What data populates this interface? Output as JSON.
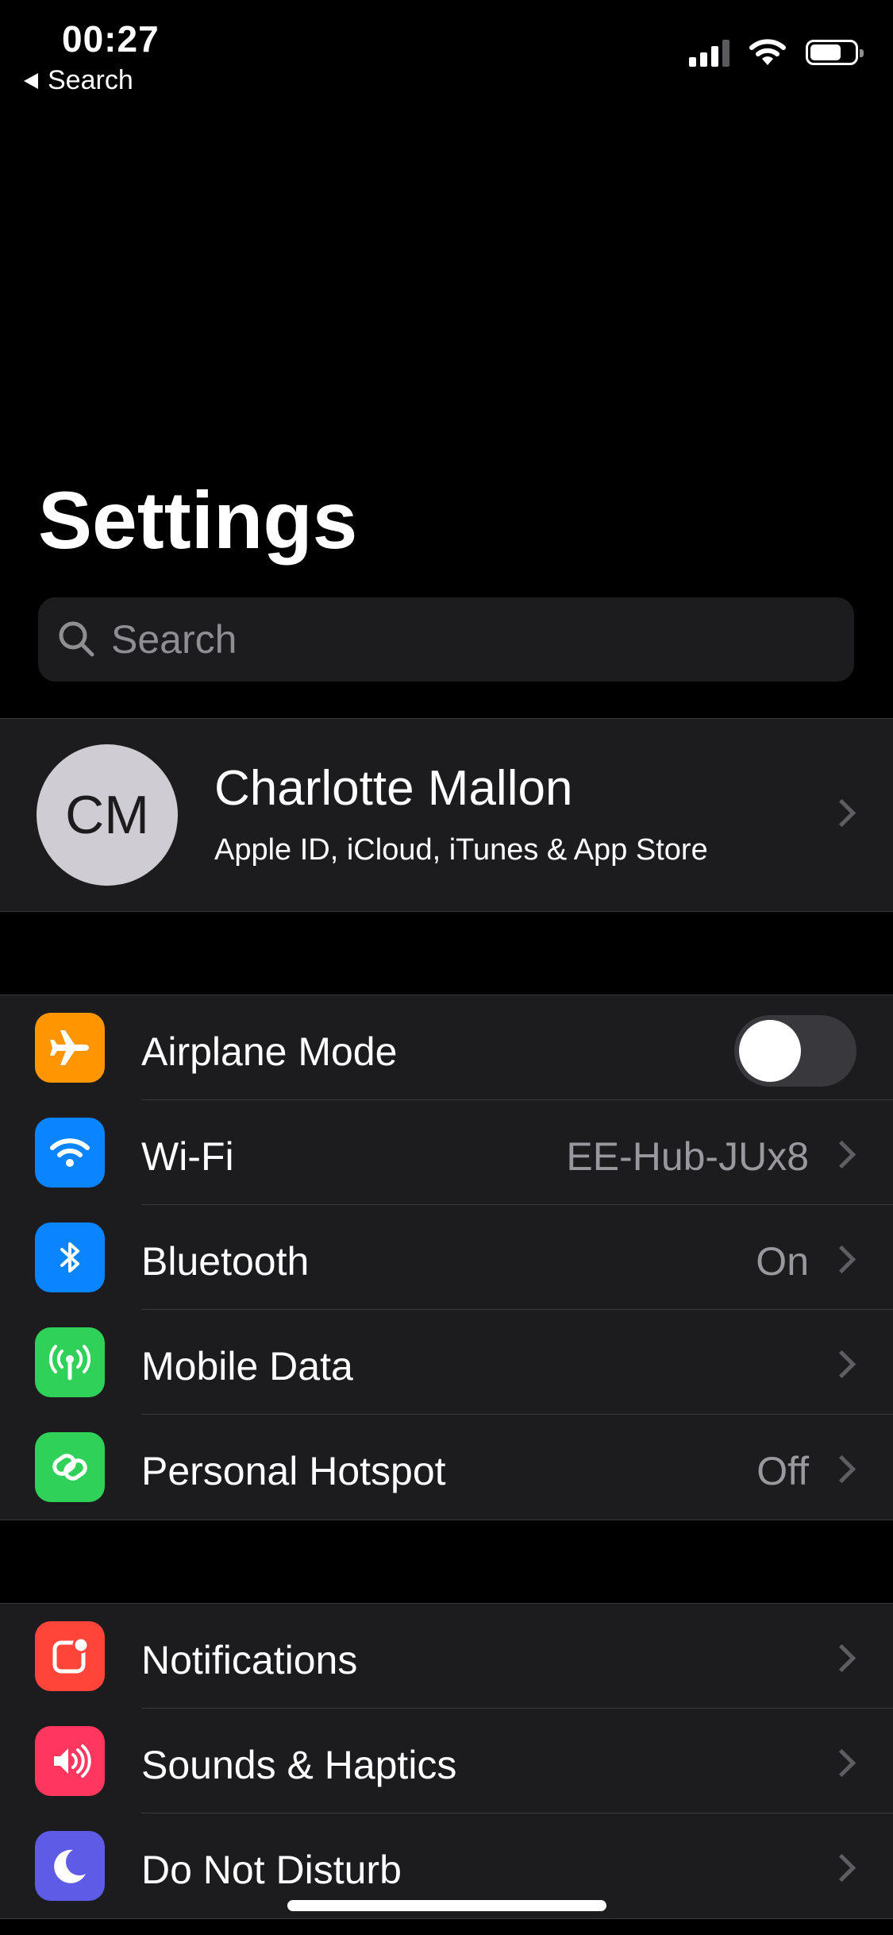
{
  "status_bar": {
    "time": "00:27",
    "back_label": "Search",
    "signal_icon": "cellular-signal-icon",
    "wifi_icon": "wifi-icon",
    "battery_icon": "battery-icon"
  },
  "header": {
    "title": "Settings"
  },
  "search": {
    "placeholder": "Search",
    "icon": "search-icon"
  },
  "profile": {
    "initials": "CM",
    "name": "Charlotte Mallon",
    "subtitle": "Apple ID, iCloud, iTunes & App Store"
  },
  "connectivity": [
    {
      "label": "Airplane Mode",
      "value": "",
      "icon": "airplane-icon",
      "color": "#ff9500",
      "toggle": false
    },
    {
      "label": "Wi-Fi",
      "value": "EE-Hub-JUx8",
      "icon": "wifi-icon",
      "color": "#0a84ff"
    },
    {
      "label": "Bluetooth",
      "value": "On",
      "icon": "bluetooth-icon",
      "color": "#0a84ff"
    },
    {
      "label": "Mobile Data",
      "value": "",
      "icon": "antenna-icon",
      "color": "#30d158"
    },
    {
      "label": "Personal Hotspot",
      "value": "Off",
      "icon": "hotspot-icon",
      "color": "#30d158"
    }
  ],
  "notifications_group": [
    {
      "label": "Notifications",
      "icon": "notifications-icon",
      "color": "#ff453a"
    },
    {
      "label": "Sounds & Haptics",
      "icon": "speaker-icon",
      "color": "#ff375f"
    },
    {
      "label": "Do Not Disturb",
      "icon": "moon-icon",
      "color": "#5e5ce6"
    }
  ]
}
